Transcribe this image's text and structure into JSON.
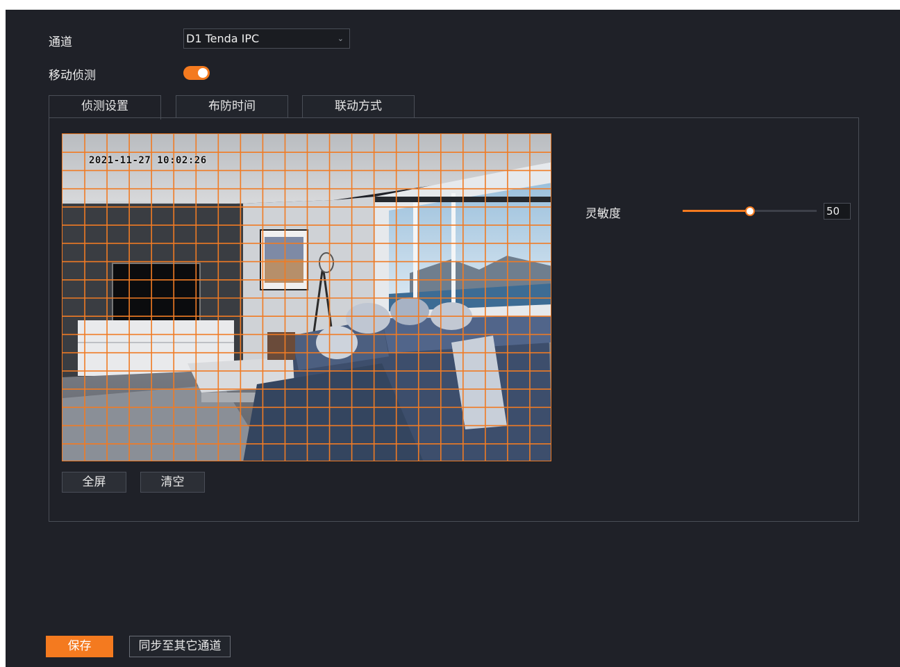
{
  "form": {
    "channel_label": "通道",
    "channel_value": "D1 Tenda IPC",
    "motion_label": "移动侦测",
    "motion_enabled": true
  },
  "tabs": [
    {
      "label": "侦测设置",
      "active": true
    },
    {
      "label": "布防时间",
      "active": false
    },
    {
      "label": "联动方式",
      "active": false
    }
  ],
  "video": {
    "timestamp": "2021-11-27 10:02:26",
    "grid_cols": 22,
    "grid_rows": 18,
    "grid_color": "#f07b24"
  },
  "video_buttons": {
    "fullscreen": "全屏",
    "clear": "清空"
  },
  "sensitivity": {
    "label": "灵敏度",
    "value": "50",
    "fraction": 0.5
  },
  "footer": {
    "save": "保存",
    "sync": "同步至其它通道"
  },
  "colors": {
    "accent": "#f47a1f",
    "background": "#1f2128",
    "border": "#4a4e57"
  }
}
